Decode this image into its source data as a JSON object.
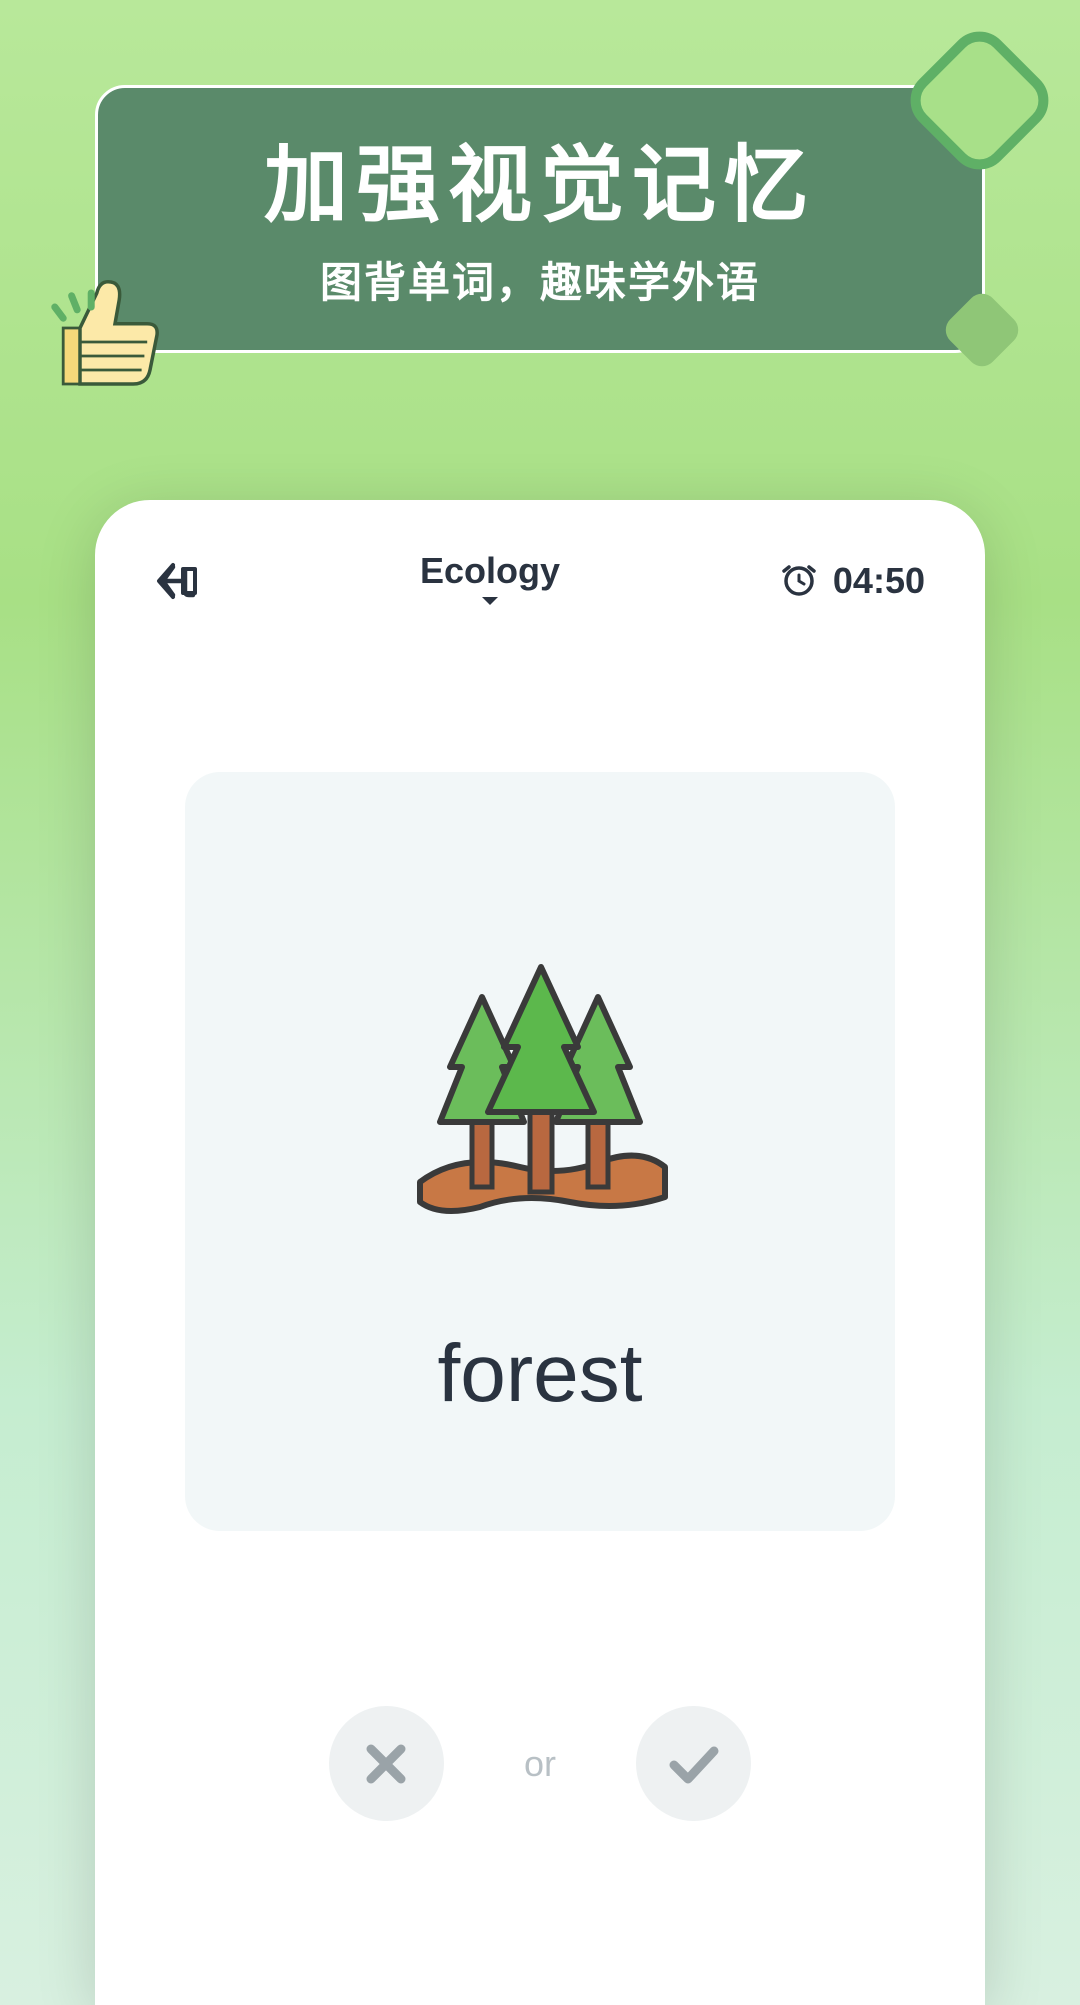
{
  "banner": {
    "title": "加强视觉记忆",
    "subtitle": "图背单词，趣味学外语"
  },
  "header": {
    "category": "Ecology",
    "timer": "04:50"
  },
  "flashcard": {
    "word": "forest",
    "icon": "forest-icon"
  },
  "actions": {
    "or_label": "or"
  }
}
